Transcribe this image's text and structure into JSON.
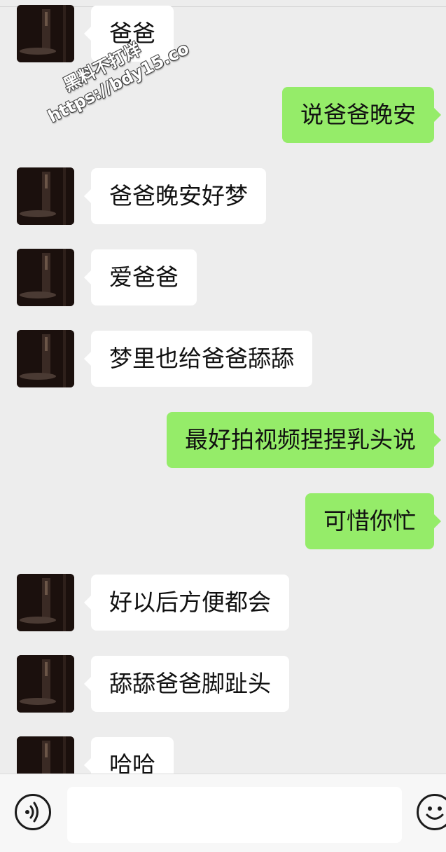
{
  "messages": [
    {
      "side": "in",
      "text": "爸爸"
    },
    {
      "side": "out",
      "text": "说爸爸晚安"
    },
    {
      "side": "in",
      "text": "爸爸晚安好梦"
    },
    {
      "side": "in",
      "text": "爱爸爸"
    },
    {
      "side": "in",
      "text": "梦里也给爸爸舔舔"
    },
    {
      "side": "out",
      "text": "最好拍视频捏捏乳头说"
    },
    {
      "side": "out",
      "text": "可惜你忙"
    },
    {
      "side": "in",
      "text": "好以后方便都会"
    },
    {
      "side": "in",
      "text": "舔舔爸爸脚趾头"
    },
    {
      "side": "in",
      "text": "哈哈"
    }
  ],
  "watermark": {
    "line1": "黑料不打烊",
    "line2": "https://bdy15.co"
  },
  "input_bar": {
    "text_value": "",
    "voice_icon": "voice-icon",
    "emoji_icon": "emoji-icon"
  },
  "colors": {
    "background": "#ededed",
    "incoming_bubble": "#ffffff",
    "outgoing_bubble": "#95ec69"
  }
}
